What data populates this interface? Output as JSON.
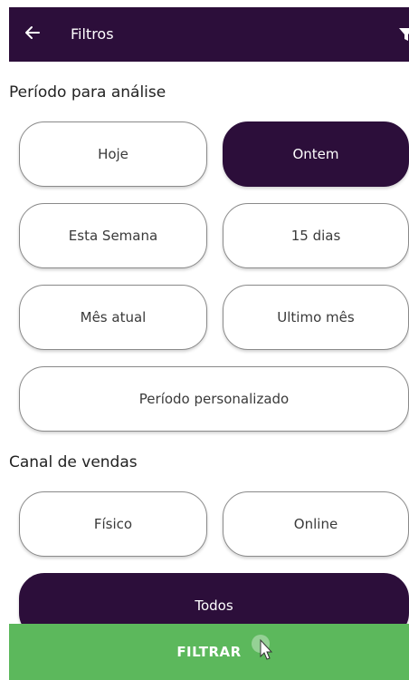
{
  "header": {
    "title": "Filtros",
    "back_icon": "arrow-left-icon",
    "filter_icon": "filter-icon",
    "background": "#2c0e3a"
  },
  "period": {
    "title": "Período para análise",
    "options": [
      {
        "label": "Hoje",
        "selected": false
      },
      {
        "label": "Ontem",
        "selected": true
      },
      {
        "label": "Esta Semana",
        "selected": false
      },
      {
        "label": "15 dias",
        "selected": false
      },
      {
        "label": "Mês atual",
        "selected": false
      },
      {
        "label": "Ultimo mês",
        "selected": false
      },
      {
        "label": "Período personalizado",
        "selected": false
      }
    ]
  },
  "channel": {
    "title": "Canal de vendas",
    "options": [
      {
        "label": "Físico",
        "selected": false
      },
      {
        "label": "Online",
        "selected": false
      },
      {
        "label": "Todos",
        "selected": true
      }
    ]
  },
  "footer": {
    "filter_button_label": "FILTRAR",
    "background": "#5cb85c"
  },
  "colors": {
    "accent": "#2c0e3a",
    "primary_action": "#5cb85c"
  }
}
